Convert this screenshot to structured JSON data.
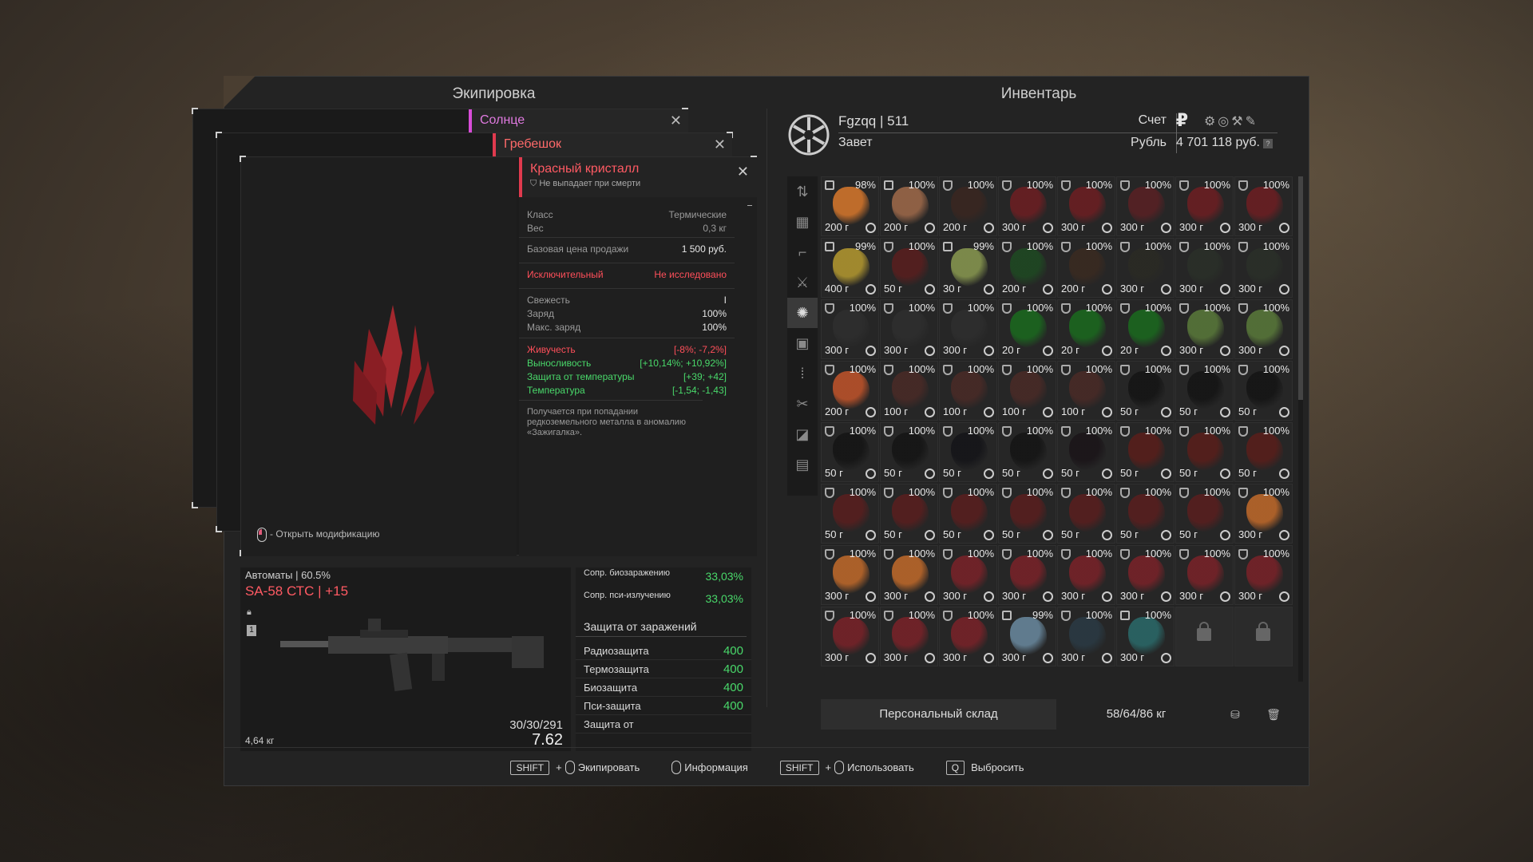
{
  "equipment": {
    "title": "Экипировка",
    "card_sun": "Солнце",
    "card_comb": "Гребешок",
    "open_mod": "- Открыть модификацию"
  },
  "item": {
    "name": "Красный кристалл",
    "note": "Не выпадает при смерти",
    "class_label": "Класс",
    "class_value": "Термические",
    "weight_label": "Вес",
    "weight_value": "0,3 кг",
    "price_label": "Базовая цена продажи",
    "price_value": "1 500 руб.",
    "rarity": "Исключительный",
    "research": "Не исследовано",
    "fresh_label": "Свежесть",
    "fresh_value": "I",
    "charge_label": "Заряд",
    "charge_value": "100%",
    "maxcharge_label": "Макс. заряд",
    "maxcharge_value": "100%",
    "s1_label": "Живучесть",
    "s1_value": "[-8%; -7,2%]",
    "s2_label": "Выносливость",
    "s2_value": "[+10,14%; +10,92%]",
    "s3_label": "Защита от температуры",
    "s3_value": "[+39; +42]",
    "s4_label": "Температура",
    "s4_value": "[-1,54; -1,43]",
    "desc": "Получается при попадании редкоземельного металла в аномалию «Зажигалка»."
  },
  "weapon": {
    "category": "Автоматы | 60.5%",
    "name": "SA-58 СТС | +15",
    "slot": "1",
    "weight": "4,64 кг",
    "ammo": "30/30/291",
    "caliber": "7.62"
  },
  "stats": {
    "bio_label": "Сопр. биозаражению",
    "bio_value": "33,03%",
    "psi_label": "Сопр. пси-излучению",
    "psi_value": "33,03%",
    "head": "Защита от заражений",
    "rows": [
      {
        "label": "Радиозащита",
        "value": "400"
      },
      {
        "label": "Термозащита",
        "value": "400"
      },
      {
        "label": "Биозащита",
        "value": "400"
      },
      {
        "label": "Пси-защита",
        "value": "400"
      },
      {
        "label": "Защита от",
        "value": ""
      }
    ]
  },
  "inventory": {
    "title": "Инвентарь",
    "username": "Fgzqq | 511",
    "faction": "Завет",
    "account_label": "Счет",
    "currency_label": "Рубль",
    "balance": "4 701 118 руб.",
    "storage_name": "Персональный склад",
    "storage_weight": "58/64/86 кг"
  },
  "grid": [
    {
      "p": "98%",
      "w": "200 г",
      "c": "#d9782c",
      "lock": true
    },
    {
      "p": "100%",
      "w": "200 г",
      "c": "#a06a4a",
      "lock": true
    },
    {
      "p": "100%",
      "w": "200 г",
      "c": "#3a2620"
    },
    {
      "p": "100%",
      "w": "300 г",
      "c": "#6e1e22"
    },
    {
      "p": "100%",
      "w": "300 г",
      "c": "#6e1e22"
    },
    {
      "p": "100%",
      "w": "300 г",
      "c": "#5a2024"
    },
    {
      "p": "100%",
      "w": "300 г",
      "c": "#6e1e22"
    },
    {
      "p": "100%",
      "w": "300 г",
      "c": "#6e1e22"
    },
    {
      "p": "99%",
      "w": "400 г",
      "c": "#b59a30",
      "lock": true
    },
    {
      "p": "100%",
      "w": "50 г",
      "c": "#5a1e1e"
    },
    {
      "p": "99%",
      "w": "30 г",
      "c": "#8a9a50",
      "lock": true
    },
    {
      "p": "100%",
      "w": "200 г",
      "c": "#1e4a22"
    },
    {
      "p": "100%",
      "w": "200 г",
      "c": "#3a2a20"
    },
    {
      "p": "100%",
      "w": "300 г",
      "c": "#2a2a24"
    },
    {
      "p": "100%",
      "w": "300 г",
      "c": "#2a3028"
    },
    {
      "p": "100%",
      "w": "300 г",
      "c": "#2a3028"
    },
    {
      "p": "100%",
      "w": "300 г",
      "c": "#2e2e2e"
    },
    {
      "p": "100%",
      "w": "300 г",
      "c": "#2e2e2e"
    },
    {
      "p": "100%",
      "w": "300 г",
      "c": "#2e2e2e"
    },
    {
      "p": "100%",
      "w": "20 г",
      "c": "#1a6a1e"
    },
    {
      "p": "100%",
      "w": "20 г",
      "c": "#1a6a1e"
    },
    {
      "p": "100%",
      "w": "20 г",
      "c": "#1a6a1e"
    },
    {
      "p": "100%",
      "w": "300 г",
      "c": "#5a7a3a"
    },
    {
      "p": "100%",
      "w": "300 г",
      "c": "#5a7a3a"
    },
    {
      "p": "100%",
      "w": "200 г",
      "c": "#c2542a"
    },
    {
      "p": "100%",
      "w": "100 г",
      "c": "#4a2a26"
    },
    {
      "p": "100%",
      "w": "100 г",
      "c": "#4a2a26"
    },
    {
      "p": "100%",
      "w": "100 г",
      "c": "#4a2a26"
    },
    {
      "p": "100%",
      "w": "100 г",
      "c": "#4a2a26"
    },
    {
      "p": "100%",
      "w": "50 г",
      "c": "#141414"
    },
    {
      "p": "100%",
      "w": "50 г",
      "c": "#141414"
    },
    {
      "p": "100%",
      "w": "50 г",
      "c": "#141414"
    },
    {
      "p": "100%",
      "w": "50 г",
      "c": "#141414"
    },
    {
      "p": "100%",
      "w": "50 г",
      "c": "#141414"
    },
    {
      "p": "100%",
      "w": "50 г",
      "c": "#141418"
    },
    {
      "p": "100%",
      "w": "50 г",
      "c": "#141414"
    },
    {
      "p": "100%",
      "w": "50 г",
      "c": "#1a1418"
    },
    {
      "p": "100%",
      "w": "50 г",
      "c": "#5a1e1a"
    },
    {
      "p": "100%",
      "w": "50 г",
      "c": "#5a1e1a"
    },
    {
      "p": "100%",
      "w": "50 г",
      "c": "#5a1e1a"
    },
    {
      "p": "100%",
      "w": "50 г",
      "c": "#5a1e1e"
    },
    {
      "p": "100%",
      "w": "50 г",
      "c": "#5a1e1e"
    },
    {
      "p": "100%",
      "w": "50 г",
      "c": "#5a1e1e"
    },
    {
      "p": "100%",
      "w": "50 г",
      "c": "#5a1e1e"
    },
    {
      "p": "100%",
      "w": "50 г",
      "c": "#5a1e1e"
    },
    {
      "p": "100%",
      "w": "50 г",
      "c": "#5a1e1e"
    },
    {
      "p": "100%",
      "w": "50 г",
      "c": "#5a1e1e"
    },
    {
      "p": "100%",
      "w": "300 г",
      "c": "#c26a2a"
    },
    {
      "p": "100%",
      "w": "300 г",
      "c": "#c26a2a"
    },
    {
      "p": "100%",
      "w": "300 г",
      "c": "#c26a2a"
    },
    {
      "p": "100%",
      "w": "300 г",
      "c": "#7a2228"
    },
    {
      "p": "100%",
      "w": "300 г",
      "c": "#7a2228"
    },
    {
      "p": "100%",
      "w": "300 г",
      "c": "#7a2228"
    },
    {
      "p": "100%",
      "w": "300 г",
      "c": "#7a2228"
    },
    {
      "p": "100%",
      "w": "300 г",
      "c": "#7a2228"
    },
    {
      "p": "100%",
      "w": "300 г",
      "c": "#7a2228"
    },
    {
      "p": "100%",
      "w": "300 г",
      "c": "#7a2228"
    },
    {
      "p": "100%",
      "w": "300 г",
      "c": "#7a2228"
    },
    {
      "p": "100%",
      "w": "300 г",
      "c": "#7a2228"
    },
    {
      "p": "99%",
      "w": "300 г",
      "c": "#6a8aa0",
      "lock": true
    },
    {
      "p": "100%",
      "w": "300 г",
      "c": "#2a3a44"
    },
    {
      "p": "100%",
      "w": "300 г",
      "c": "#2a6a6a",
      "lock": true
    },
    {
      "locked": true
    },
    {
      "locked": true
    }
  ],
  "footer": {
    "shift": "SHIFT",
    "plus": "+",
    "equip": "Экипировать",
    "info": "Информация",
    "use": "Использовать",
    "qkey": "Q",
    "drop": "Выбросить"
  }
}
